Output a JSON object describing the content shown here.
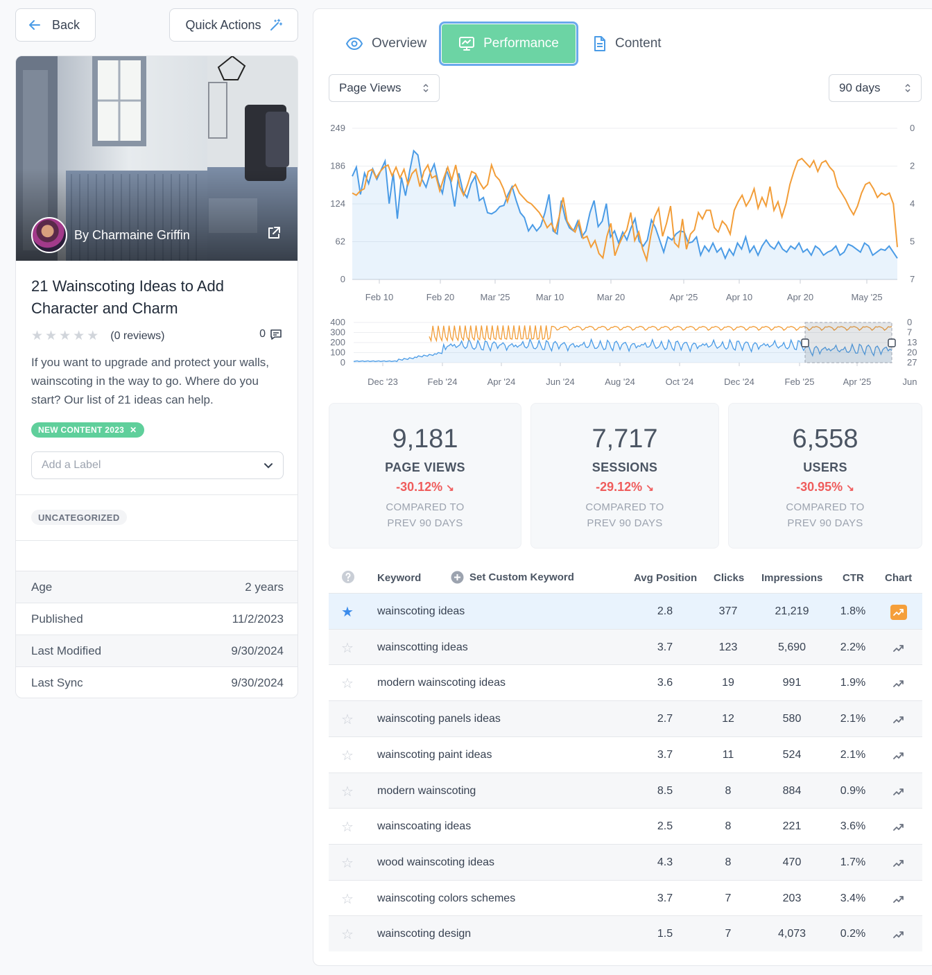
{
  "nav": {
    "back_label": "Back",
    "quick_actions_label": "Quick Actions"
  },
  "article": {
    "author": "By Charmaine Griffin",
    "title": "21 Wainscoting Ideas to Add Character and Charm",
    "reviews": "(0 reviews)",
    "comment_count": "0",
    "rating": 0,
    "description": "If you want to upgrade and protect your walls, wainscoting in the way to go. Where do you start? Our list of 21 ideas can help.",
    "tag": "NEW CONTENT 2023",
    "label_placeholder": "Add a Label",
    "category": "UNCATEGORIZED",
    "meta": [
      {
        "label": "Age",
        "value": "2 years"
      },
      {
        "label": "Published",
        "value": "11/2/2023"
      },
      {
        "label": "Last Modified",
        "value": "9/30/2024"
      },
      {
        "label": "Last Sync",
        "value": "9/30/2024"
      }
    ]
  },
  "tabs": [
    {
      "label": "Overview",
      "icon": "eye-icon"
    },
    {
      "label": "Performance",
      "icon": "monitor-chart-icon",
      "active": true
    },
    {
      "label": "Content",
      "icon": "document-icon"
    }
  ],
  "filters": {
    "metric": "Page Views",
    "range": "90 days"
  },
  "colors": {
    "page_views": "#4a9be6",
    "position": "#f29d38",
    "accent": "#6cd4a4",
    "negative": "#ef5c5c"
  },
  "chart_data": [
    {
      "type": "line",
      "y_ticks_left": [
        "249",
        "186",
        "124",
        "62",
        "0"
      ],
      "y_ticks_right": [
        "0",
        "2",
        "4",
        "5",
        "7"
      ],
      "x_ticks": [
        "Feb 10",
        "Feb 20",
        "Mar '25",
        "Mar 10",
        "Mar 20",
        "Apr '25",
        "Apr 10",
        "Apr 20",
        "May '25"
      ],
      "ylim_left": [
        0,
        249
      ],
      "ylim_right": [
        7,
        0
      ],
      "series": [
        {
          "values": [
            170,
            185,
            140,
            175,
            158,
            182,
            165,
            180,
            195,
            125,
            175,
            100,
            168,
            138,
            178,
            212,
            205,
            165,
            152,
            175,
            190,
            160,
            142,
            180,
            162,
            120,
            175,
            145,
            135,
            158,
            170,
            130,
            135,
            110,
            108,
            112,
            120,
            122,
            140,
            153,
            130,
            110,
            102,
            80,
            90,
            80,
            88,
            110,
            140,
            80,
            75,
            130,
            100,
            85,
            80,
            96,
            70,
            80,
            110,
            130,
            87,
            96,
            125,
            70,
            80,
            60,
            78,
            65,
            85,
            100,
            63,
            55,
            65,
            98,
            85,
            65,
            45,
            70,
            65,
            75,
            80,
            78,
            60,
            62,
            70,
            40,
            55,
            46,
            60,
            45,
            52,
            35,
            50,
            40,
            60,
            50,
            70,
            45,
            55,
            40,
            55,
            65,
            55,
            50,
            62,
            50,
            45,
            55,
            50,
            60,
            45,
            50,
            40,
            55,
            50,
            40,
            45,
            48,
            55,
            40,
            45,
            58,
            55,
            50,
            45,
            60,
            55,
            40,
            45,
            50,
            48,
            55,
            45,
            35
          ]
        },
        {
          "values": [
            3.0,
            3.1,
            2.9,
            2.8,
            2.0,
            1.9,
            2.3,
            2.0,
            1.8,
            1.7,
            2.2,
            1.8,
            2.3,
            1.9,
            2.6,
            2.1,
            1.9,
            2.7,
            2.0,
            1.7,
            2.3,
            2.2,
            2.9,
            2.3,
            1.8,
            2.4,
            1.7,
            2.7,
            3.1,
            2.6,
            2.0,
            2.1,
            2.5,
            2.8,
            2.6,
            1.7,
            2.2,
            2.4,
            2.8,
            3.4,
            2.8,
            2.6,
            3.0,
            3.2,
            3.4,
            3.5,
            3.7,
            3.9,
            4.2,
            4.6,
            4.4,
            4.8,
            4.1,
            3.2,
            4.3,
            4.6,
            4.8,
            4.3,
            5.1,
            5.0,
            5.5,
            5.2,
            5.8,
            6.0,
            5.0,
            4.4,
            5.9,
            5.4,
            5.0,
            4.7,
            3.9,
            5.2,
            4.8,
            5.6,
            6.1,
            5.0,
            4.1,
            3.7,
            5.0,
            4.4,
            3.6,
            5.3,
            5.5,
            4.2,
            5.6,
            4.9,
            4.7,
            3.9,
            4.2,
            3.8,
            3.8,
            4.6,
            4.8,
            4.3,
            4.5,
            4.9,
            3.8,
            3.4,
            3.1,
            3.6,
            3.3,
            2.8,
            3.7,
            3.2,
            3.6,
            2.7,
            3.8,
            3.4,
            4.1,
            3.5,
            2.6,
            2.0,
            1.5,
            1.4,
            1.6,
            1.8,
            1.5,
            2.0,
            1.6,
            1.5,
            1.8,
            2.0,
            2.7,
            3.0,
            3.3,
            3.7,
            4.0,
            3.6,
            3.0,
            2.6,
            2.5,
            2.8,
            3.2,
            3.0,
            3.1,
            3.0,
            3.5,
            5.5
          ]
        }
      ]
    },
    {
      "type": "line",
      "y_ticks_left": [
        "400",
        "300",
        "200",
        "100",
        "0"
      ],
      "y_ticks_right": [
        "0",
        "7",
        "13",
        "20",
        "27"
      ],
      "x_ticks": [
        "Dec '23",
        "Feb '24",
        "Apr '24",
        "Jun '24",
        "Aug '24",
        "Oct '24",
        "Dec '24",
        "Feb '25",
        "Apr '25",
        "Jun"
      ],
      "ylim_left": [
        0,
        400
      ],
      "ylim_right": [
        27,
        0
      ],
      "selected_range": [
        "Feb '25",
        "Apr '25"
      ]
    }
  ],
  "stats": [
    {
      "value": "9,181",
      "label": "PAGE VIEWS",
      "change": "-30.12%",
      "compare": "COMPARED TO",
      "compare2": "PREV 90 DAYS"
    },
    {
      "value": "7,717",
      "label": "SESSIONS",
      "change": "-29.12%",
      "compare": "COMPARED TO",
      "compare2": "PREV 90 DAYS"
    },
    {
      "value": "6,558",
      "label": "USERS",
      "change": "-30.95%",
      "compare": "COMPARED TO",
      "compare2": "PREV 90 DAYS"
    }
  ],
  "keywords": {
    "headers": {
      "keyword": "Keyword",
      "custom": "Set Custom Keyword",
      "pos": "Avg Position",
      "clicks": "Clicks",
      "imp": "Impressions",
      "ctr": "CTR",
      "chart": "Chart"
    },
    "rows": [
      {
        "keyword": "wainscoting ideas",
        "pos": "2.8",
        "clicks": "377",
        "imp": "21,219",
        "ctr": "1.8%",
        "starred": true
      },
      {
        "keyword": "wainscotting ideas",
        "pos": "3.7",
        "clicks": "123",
        "imp": "5,690",
        "ctr": "2.2%"
      },
      {
        "keyword": "modern wainscoting ideas",
        "pos": "3.6",
        "clicks": "19",
        "imp": "991",
        "ctr": "1.9%"
      },
      {
        "keyword": "wainscoting panels ideas",
        "pos": "2.7",
        "clicks": "12",
        "imp": "580",
        "ctr": "2.1%"
      },
      {
        "keyword": "wainscoting paint ideas",
        "pos": "3.7",
        "clicks": "11",
        "imp": "524",
        "ctr": "2.1%"
      },
      {
        "keyword": "modern wainscoting",
        "pos": "8.5",
        "clicks": "8",
        "imp": "884",
        "ctr": "0.9%"
      },
      {
        "keyword": "wainscoating ideas",
        "pos": "2.5",
        "clicks": "8",
        "imp": "221",
        "ctr": "3.6%"
      },
      {
        "keyword": "wood wainscoting ideas",
        "pos": "4.3",
        "clicks": "8",
        "imp": "470",
        "ctr": "1.7%"
      },
      {
        "keyword": "wainscoting colors schemes",
        "pos": "3.7",
        "clicks": "7",
        "imp": "203",
        "ctr": "3.4%"
      },
      {
        "keyword": "wainscoting design",
        "pos": "1.5",
        "clicks": "7",
        "imp": "4,073",
        "ctr": "0.2%"
      }
    ]
  }
}
